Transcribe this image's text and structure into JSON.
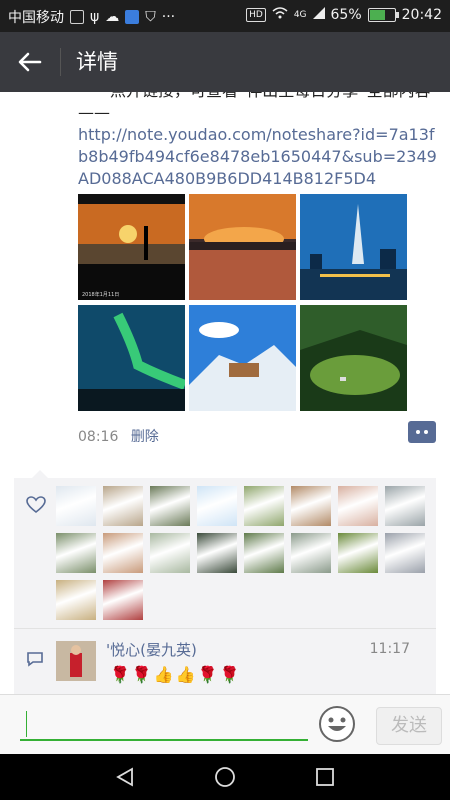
{
  "status": {
    "carrier": "中国移动",
    "network": "4G",
    "battery": "65%",
    "battery_fraction": 0.65,
    "time": "20:42"
  },
  "header": {
    "title": "详情"
  },
  "post": {
    "text": "——点开链接，可查看“伴出生每日分享”全部内容——",
    "link": "http://note.youdao.com/noteshare?id=7a13fb8b49fb494cf6e8478eb1650447&sub=2349AD088ACA480B9B6DD414B812F5D4",
    "image_caption": "2018年1月11日",
    "time": "08:16",
    "delete_label": "删除"
  },
  "colors": {
    "header_bg": "#393a3f",
    "link": "#576b95",
    "accent_green": "#35b035"
  },
  "comment": {
    "name": "'悦心(晏九英)",
    "time": "11:17",
    "emoji": "🌹🌹👍👍🌹🌹"
  },
  "input": {
    "placeholder": "",
    "send_label": "发送"
  }
}
